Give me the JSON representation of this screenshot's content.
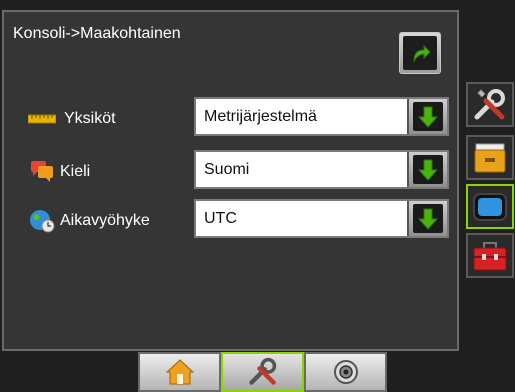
{
  "header": {
    "title": "Konsoli->Maakohtainen"
  },
  "rows": [
    {
      "label": "Yksiköt",
      "value": "Metrijärjestelmä",
      "icon": "ruler-icon"
    },
    {
      "label": "Kieli",
      "value": "Suomi",
      "icon": "speech-bubbles-icon"
    },
    {
      "label": "Aikavyöhyke",
      "value": "UTC",
      "icon": "globe-clock-icon"
    }
  ],
  "side_tabs": [
    {
      "icon": "tools-icon",
      "active": false
    },
    {
      "icon": "file-box-icon",
      "active": false
    },
    {
      "icon": "display-icon",
      "active": true
    },
    {
      "icon": "toolbox-icon",
      "active": false
    }
  ],
  "bottom_tabs": [
    {
      "icon": "home-icon",
      "active": false
    },
    {
      "icon": "tools-icon",
      "active": true
    },
    {
      "icon": "gps-dial-icon",
      "active": false
    }
  ],
  "colors": {
    "accent": "#8bd400",
    "arrow_green": "#49b30f",
    "panel": "#353535"
  }
}
